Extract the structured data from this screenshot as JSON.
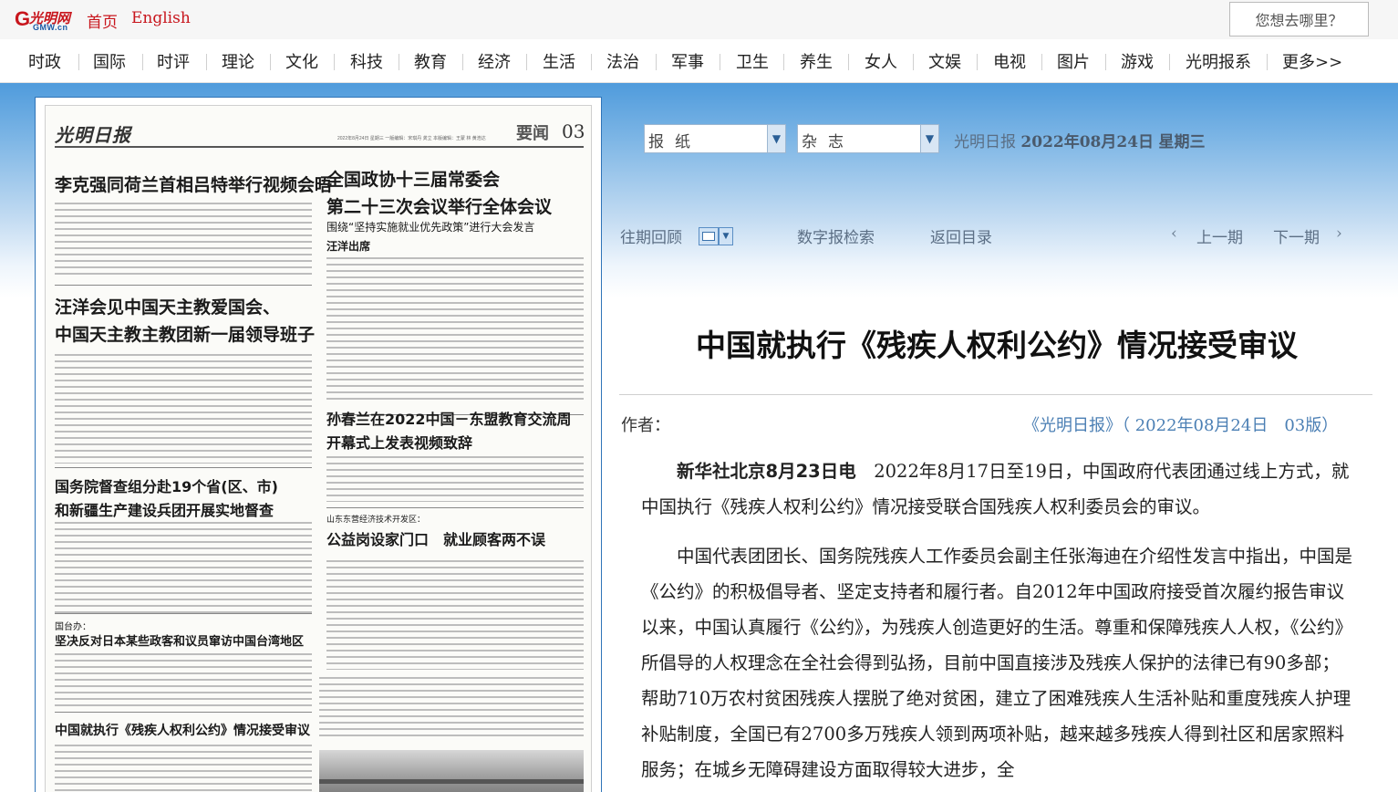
{
  "site": {
    "logo_cn": "光明网",
    "logo_en": "GMW.cn",
    "links": [
      "首页",
      "English"
    ],
    "search_label": "您想去哪里？"
  },
  "nav": [
    "时政",
    "国际",
    "时评",
    "理论",
    "文化",
    "科技",
    "教育",
    "经济",
    "生活",
    "法治",
    "军事",
    "卫生",
    "养生",
    "女人",
    "文娱",
    "电视",
    "图片",
    "游戏",
    "光明报系",
    "更多>>"
  ],
  "paper": {
    "masthead": "光明日报",
    "meta": "2022年8月24日  星期三  一版编辑：宋琪丹 龚立  本版编辑：王蒙 林 黄浩达",
    "page_name": "要闻",
    "page_number": "03",
    "headlines": {
      "h1": "李克强同荷兰首相吕特举行视频会晤",
      "h2a": "全国政协十三届常委会",
      "h2b": "第二十三次会议举行全体会议",
      "h2_sub": "围绕“坚持实施就业优先政策”进行大会发言",
      "h2_sub2": "汪洋出席",
      "h3a": "汪洋会见中国天主教爱国会、",
      "h3b": "中国天主教主教团新一届领导班子",
      "h4a": "孙春兰在2022中国－东盟教育交流周",
      "h4b": "开幕式上发表视频致辞",
      "h5a": "国务院督查组分赴19个省(区、市)",
      "h5b": "和新疆生产建设兵团开展实地督查",
      "h6_kicker": "山东东营经济技术开发区：",
      "h6": "公益岗设家门口　就业顾客两不误",
      "h7_kicker": "国台办：",
      "h7": "坚决反对日本某些政客和议员窜访中国台湾地区",
      "h8": "中国就执行《残疾人权利公约》情况接受审议"
    }
  },
  "controls": {
    "select_paper": "报纸",
    "select_magazine": "杂志",
    "paper_name": "光明日报",
    "date": "2022年08月24日",
    "weekday": "星期三",
    "archive": "往期回顾",
    "search": "数字报检索",
    "back": "返回目录",
    "prev": "上一期",
    "next": "下一期",
    "prev_arrow": "‹",
    "next_arrow": "›"
  },
  "article": {
    "title": "中国就执行《残疾人权利公约》情况接受审议",
    "author_label": "作者：",
    "source": "《光明日报》（ 2022年08月24日　03版）",
    "lead": "新华社北京8月23日电",
    "p1": "　2022年8月17日至19日，中国政府代表团通过线上方式，就中国执行《残疾人权利公约》情况接受联合国残疾人权利委员会的审议。",
    "p2": "中国代表团团长、国务院残疾人工作委员会副主任张海迪在介绍性发言中指出，中国是《公约》的积极倡导者、坚定支持者和履行者。自2012年中国政府接受首次履约报告审议以来，中国认真履行《公约》，为残疾人创造更好的生活。尊重和保障残疾人人权，《公约》所倡导的人权理念在全社会得到弘扬，目前中国直接涉及残疾人保护的法律已有90多部；帮助710万农村贫困残疾人摆脱了绝对贫困，建立了困难残疾人生活补贴和重度残疾人护理补贴制度，全国已有2700多万残疾人领到两项补贴，越来越多残疾人得到社区和居家照料服务；在城乡无障碍建设方面取得较大进步，全"
  }
}
